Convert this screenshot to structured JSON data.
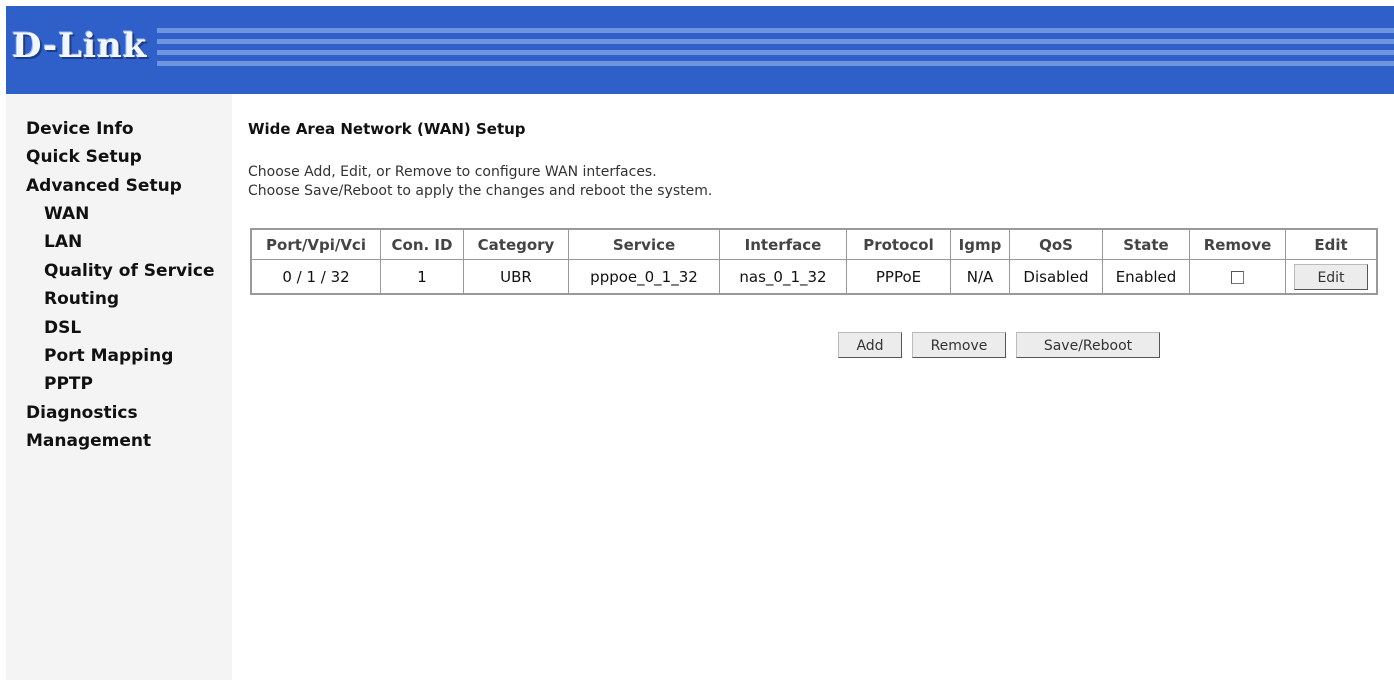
{
  "header": {
    "logo": "D-Link"
  },
  "sidebar": {
    "items": [
      {
        "label": "Device Info"
      },
      {
        "label": "Quick Setup"
      },
      {
        "label": "Advanced Setup"
      },
      {
        "label": "WAN"
      },
      {
        "label": "LAN"
      },
      {
        "label": "Quality of Service"
      },
      {
        "label": "Routing"
      },
      {
        "label": "DSL"
      },
      {
        "label": "Port Mapping"
      },
      {
        "label": "PPTP"
      },
      {
        "label": "Diagnostics"
      },
      {
        "label": "Management"
      }
    ]
  },
  "main": {
    "title": "Wide Area Network (WAN) Setup",
    "desc1": "Choose Add, Edit, or Remove to configure WAN interfaces.",
    "desc2": "Choose Save/Reboot to apply the changes and reboot the system.",
    "table": {
      "headers": [
        "Port/Vpi/Vci",
        "Con. ID",
        "Category",
        "Service",
        "Interface",
        "Protocol",
        "Igmp",
        "QoS",
        "State",
        "Remove",
        "Edit"
      ],
      "rows": [
        {
          "port": "0 / 1 / 32",
          "con_id": "1",
          "category": "UBR",
          "service": "pppoe_0_1_32",
          "interface": "nas_0_1_32",
          "protocol": "PPPoE",
          "igmp": "N/A",
          "qos": "Disabled",
          "state": "Enabled",
          "remove_checked": false,
          "edit_label": "Edit"
        }
      ]
    },
    "buttons": {
      "add": "Add",
      "remove": "Remove",
      "save_reboot": "Save/Reboot"
    }
  }
}
